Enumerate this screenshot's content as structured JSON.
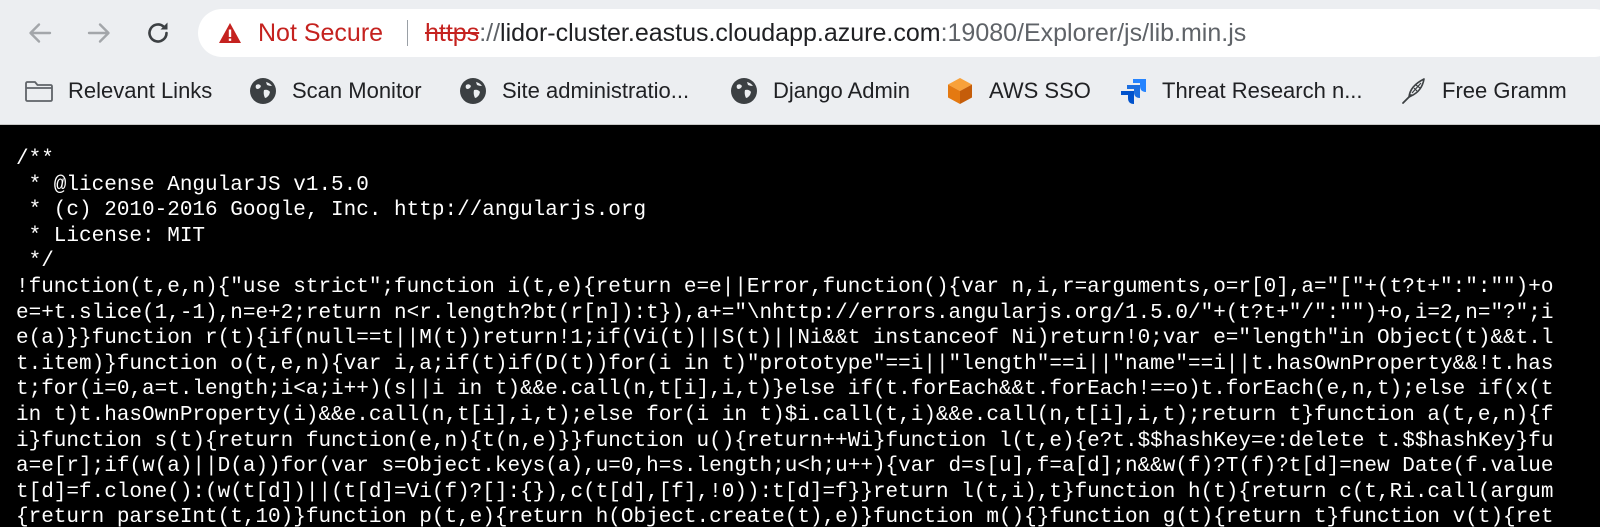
{
  "toolbar": {
    "security_label": "Not Secure",
    "url": {
      "scheme": "https",
      "separator": "://",
      "host": "lidor-cluster.eastus.cloudapp.azure.com",
      "rest": ":19080/Explorer/js/lib.min.js"
    }
  },
  "bookmarks": [
    {
      "label": "Relevant Links",
      "icon": "folder-icon"
    },
    {
      "label": "Scan Monitor",
      "icon": "globe-icon"
    },
    {
      "label": "Site administratio...",
      "icon": "globe-icon"
    },
    {
      "label": "Django Admin",
      "icon": "globe-icon"
    },
    {
      "label": "AWS SSO",
      "icon": "aws-cube-icon"
    },
    {
      "label": "Threat Research n...",
      "icon": "jira-icon"
    },
    {
      "label": "Free Gramm",
      "icon": "quill-icon"
    }
  ],
  "code_lines": [
    "/**",
    " * @license AngularJS v1.5.0",
    " * (c) 2010-2016 Google, Inc. http://angularjs.org",
    " * License: MIT",
    " */",
    "!function(t,e,n){\"use strict\";function i(t,e){return e=e||Error,function(){var n,i,r=arguments,o=r[0],a=\"[\"+(t?t+\":\":\"\")+o",
    "e=+t.slice(1,-1),n=e+2;return n<r.length?bt(r[n]):t}),a+=\"\\nhttp://errors.angularjs.org/1.5.0/\"+(t?t+\"/\":\"\")+o,i=2,n=\"?\";i",
    "e(a)}}function r(t){if(null==t||M(t))return!1;if(Vi(t)||S(t)||Ni&&t instanceof Ni)return!0;var e=\"length\"in Object(t)&&t.l",
    "t.item)}function o(t,e,n){var i,a;if(t)if(D(t))for(i in t)\"prototype\"==i||\"length\"==i||\"name\"==i||t.hasOwnProperty&&!t.has",
    "t;for(i=0,a=t.length;i<a;i++)(s||i in t)&&e.call(n,t[i],i,t)}else if(t.forEach&&t.forEach!==o)t.forEach(e,n,t);else if(x(t",
    "in t)t.hasOwnProperty(i)&&e.call(n,t[i],i,t);else for(i in t)$i.call(t,i)&&e.call(n,t[i],i,t);return t}function a(t,e,n){f",
    "i}function s(t){return function(e,n){t(n,e)}}function u(){return++Wi}function l(t,e){e?t.$$hashKey=e:delete t.$$hashKey}fu",
    "a=e[r];if(w(a)||D(a))for(var s=Object.keys(a),u=0,h=s.length;u<h;u++){var d=s[u],f=a[d];n&&w(f)?T(f)?t[d]=new Date(f.value",
    "t[d]=f.clone():(w(t[d])||(t[d]=Vi(f)?[]:{}),c(t[d],[f],!0)):t[d]=f}}return l(t,i),t}function h(t){return c(t,Ri.call(argum",
    "{return parseInt(t,10)}function p(t,e){return h(Object.create(t),e)}function m(){}function g(t){return t}function v(t){ret"
  ]
}
